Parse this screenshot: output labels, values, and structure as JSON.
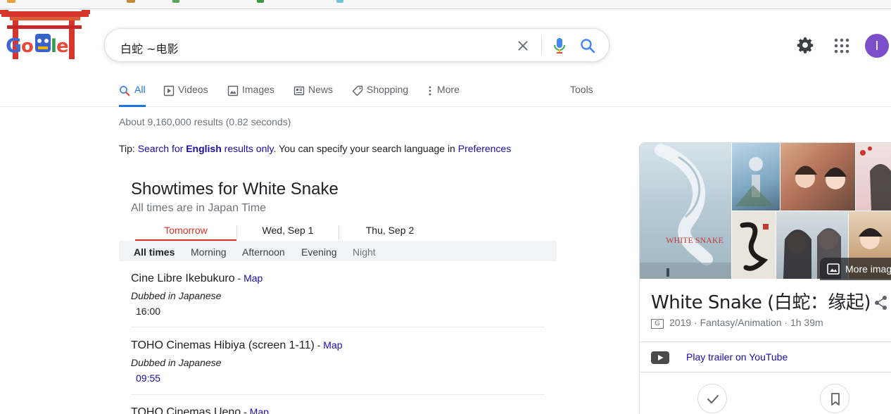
{
  "search": {
    "query": "白蛇  ~电影"
  },
  "header": {
    "avatar_letter": "I"
  },
  "tabs": [
    {
      "label": "All",
      "icon": "search-icon",
      "active": true
    },
    {
      "label": "Videos",
      "icon": "video-icon",
      "active": false
    },
    {
      "label": "Images",
      "icon": "image-icon",
      "active": false
    },
    {
      "label": "News",
      "icon": "news-icon",
      "active": false
    },
    {
      "label": "Shopping",
      "icon": "tag-icon",
      "active": false
    },
    {
      "label": "More",
      "icon": "more-vert-icon",
      "active": false
    }
  ],
  "tools_label": "Tools",
  "result_stats": "About 9,160,000 results (0.82 seconds)",
  "tip": {
    "prefix": "Tip: ",
    "search_for": "Search for ",
    "language": "English",
    "results_only": " results only",
    "middle": ". You can specify your search language in ",
    "preferences": "Preferences"
  },
  "showtimes": {
    "title": "Showtimes for White Snake",
    "subtitle": "All times are in Japan Time",
    "days": [
      "Tomorrow",
      "Wed, Sep 1",
      "Thu, Sep 2"
    ],
    "filters": [
      "All times",
      "Morning",
      "Afternoon",
      "Evening",
      "Night"
    ],
    "cinemas": [
      {
        "name": "Cine Libre Ikebukuro",
        "sep": " - ",
        "map": "Map",
        "dub": "Dubbed in Japanese",
        "time": "16:00"
      },
      {
        "name": "TOHO Cinemas Hibiya (screen 1-11)",
        "sep": " - ",
        "map": "Map",
        "dub": "Dubbed in Japanese",
        "time": "09:55"
      },
      {
        "name": "TOHO Cinemas Ueno",
        "sep": " - ",
        "map": "Map"
      }
    ]
  },
  "knowledge_panel": {
    "title": "White Snake (白蛇：缘起)",
    "rating": "G",
    "meta": "2019 · Fantasy/Animation · 1h 39m",
    "more_images": "More images",
    "trailer": "Play trailer on YouTube",
    "poster_title": "WHITE SNAKE"
  },
  "colors": {
    "link": "#1a0dab",
    "accent": "#1a73e8",
    "active_day": "#d93025",
    "avatar": "#7b4fc9"
  }
}
